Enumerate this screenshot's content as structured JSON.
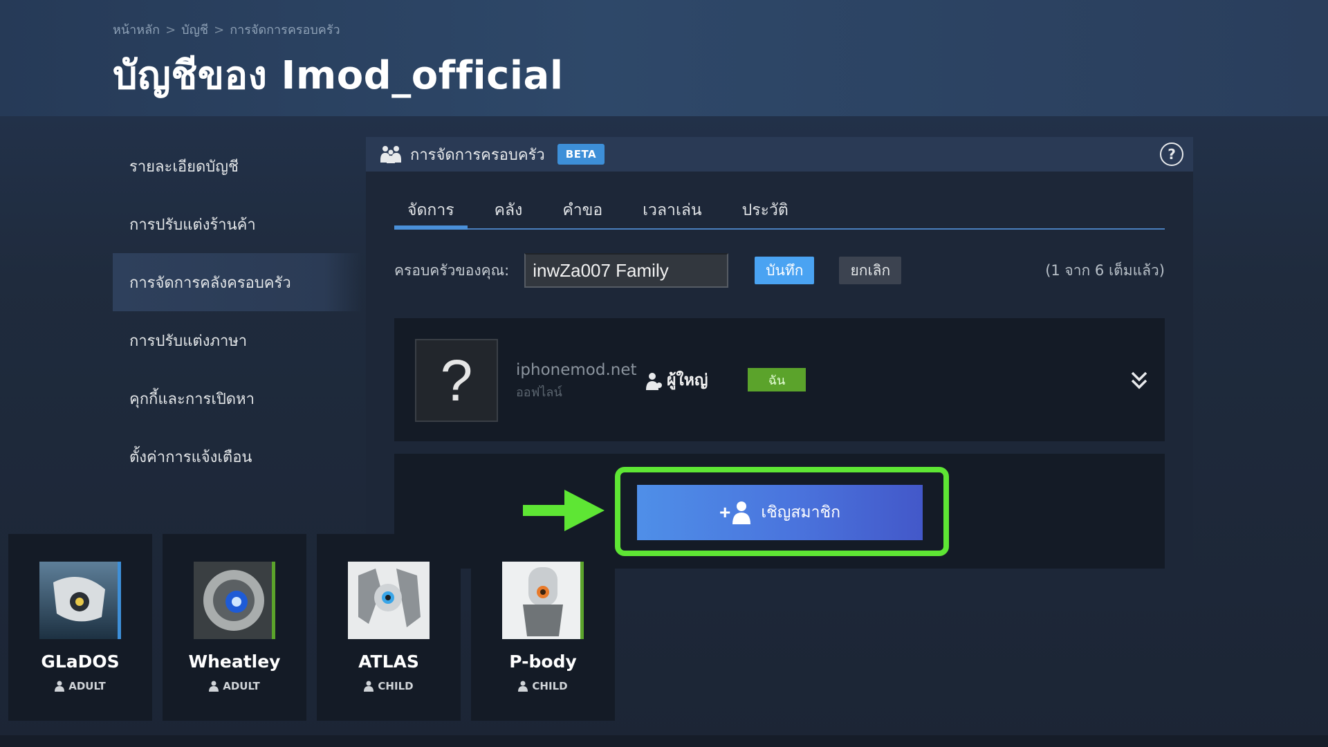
{
  "breadcrumb": {
    "home": "หน้าหลัก",
    "account": "บัญชี",
    "current": "การจัดการครอบครัว",
    "separator": ">"
  },
  "page_title": "บัญชีของ Imod_official",
  "sidebar": {
    "items": [
      {
        "label": "รายละเอียดบัญชี"
      },
      {
        "label": "การปรับแต่งร้านค้า"
      },
      {
        "label": "การจัดการคลังครอบครัว"
      },
      {
        "label": "การปรับแต่งภาษา"
      },
      {
        "label": "คุกกี้และการเปิดหา"
      },
      {
        "label": "ตั้งค่าการแจ้งเตือน"
      }
    ]
  },
  "panel": {
    "title": "การจัดการครอบครัว",
    "badge": "BETA",
    "help": "?"
  },
  "tabs": [
    {
      "label": "จัดการ"
    },
    {
      "label": "คลัง"
    },
    {
      "label": "คำขอ"
    },
    {
      "label": "เวลาเล่น"
    },
    {
      "label": "ประวัติ"
    }
  ],
  "family": {
    "label": "ครอบครัวของคุณ:",
    "name_value": "inwZa007 Family",
    "save_label": "บันทึก",
    "cancel_label": "ยกเลิก",
    "count_text": "(1 จาก 6 เต็มแล้ว)"
  },
  "member": {
    "avatar_glyph": "?",
    "name": "iphonemod.net",
    "status": "ออฟไลน์",
    "role": "ผู้ใหญ่",
    "badge": "ฉัน"
  },
  "invite": {
    "plus": "+",
    "label": "เชิญสมาชิก"
  },
  "tiles": [
    {
      "name": "GLaDOS",
      "role": "ADULT"
    },
    {
      "name": "Wheatley",
      "role": "ADULT"
    },
    {
      "name": "ATLAS",
      "role": "CHILD"
    },
    {
      "name": "P-body",
      "role": "CHILD"
    }
  ],
  "colors": {
    "accent_blue": "#4a90d9",
    "save_blue": "#4aa3f2",
    "me_green": "#5ba32b",
    "highlight_green": "#5ee634"
  }
}
